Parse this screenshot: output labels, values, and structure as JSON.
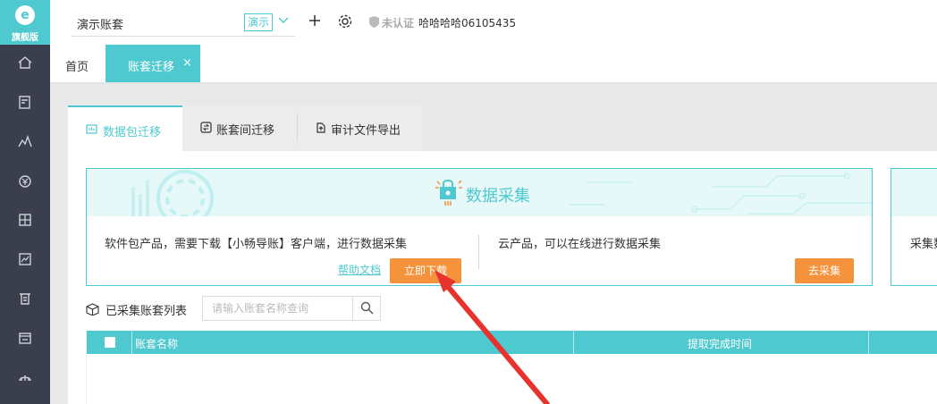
{
  "app": {
    "logo_text": "旗舰版",
    "logo_mark": "e"
  },
  "sidebar": {
    "items": [
      {
        "icon": "home-icon"
      },
      {
        "icon": "voucher-icon"
      },
      {
        "icon": "chart-icon"
      },
      {
        "icon": "money-icon"
      },
      {
        "icon": "ledger-icon"
      },
      {
        "icon": "report-icon"
      },
      {
        "icon": "tax-icon"
      },
      {
        "icon": "invoice-icon"
      },
      {
        "icon": "tools-icon"
      }
    ]
  },
  "header": {
    "account_name": "演示账套",
    "demo_badge": "演示",
    "cert_status": "未认证",
    "user": "哈哈哈哈06105435"
  },
  "tabs": {
    "home": "首页",
    "active": "账套迁移",
    "close": "×"
  },
  "subtabs": [
    {
      "label": "数据包迁移",
      "active": true
    },
    {
      "label": "账套间迁移",
      "active": false
    },
    {
      "label": "审计文件导出",
      "active": false
    }
  ],
  "card": {
    "title": "数据采集",
    "left_desc": "软件包产品，需要下载【小畅导账】客户端，进行数据采集",
    "help_link": "帮助文档",
    "download_btn": "立即下载",
    "right_desc": "云产品，可以在线进行数据采集",
    "collect_btn": "去采集"
  },
  "card2": {
    "text": "采集数据"
  },
  "list": {
    "title": "已采集账套列表",
    "search_placeholder": "请输入账套名称查询",
    "columns": [
      "账套名称",
      "提取完成时间"
    ]
  },
  "colors": {
    "accent": "#4ec9cf",
    "orange": "#f5933d",
    "sidebar": "#3b3f4d",
    "arrow": "#e8322d"
  }
}
